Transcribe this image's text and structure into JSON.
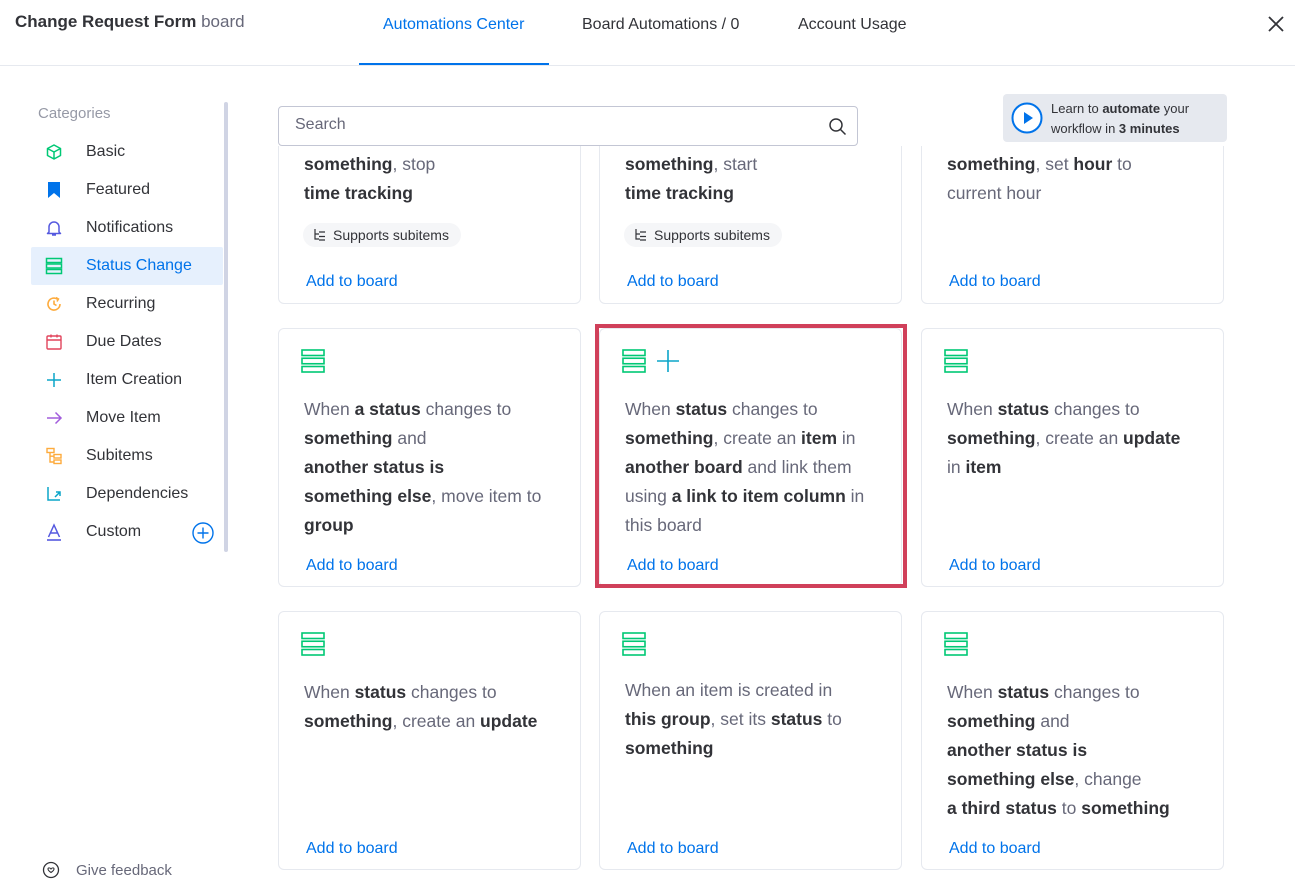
{
  "header": {
    "board_name": "Change Request Form",
    "board_suffix": "board",
    "tabs": [
      {
        "label": "Automations Center",
        "active": true
      },
      {
        "label": "Board Automations / 0",
        "active": false
      },
      {
        "label": "Account Usage",
        "active": false
      }
    ],
    "close_icon": "close-icon"
  },
  "sidebar": {
    "title": "Categories",
    "items": [
      {
        "label": "Basic",
        "icon": "cube-icon"
      },
      {
        "label": "Featured",
        "icon": "bookmark-icon"
      },
      {
        "label": "Notifications",
        "icon": "bell-icon"
      },
      {
        "label": "Status Change",
        "icon": "status-icon",
        "active": true
      },
      {
        "label": "Recurring",
        "icon": "recurring-icon"
      },
      {
        "label": "Due Dates",
        "icon": "calendar-icon"
      },
      {
        "label": "Item Creation",
        "icon": "plus-icon"
      },
      {
        "label": "Move Item",
        "icon": "arrow-right-icon"
      },
      {
        "label": "Subitems",
        "icon": "subitems-icon"
      },
      {
        "label": "Dependencies",
        "icon": "dependencies-icon"
      },
      {
        "label": "Custom",
        "icon": "custom-a-icon"
      }
    ],
    "feedback_label": "Give feedback"
  },
  "search": {
    "placeholder": "Search",
    "value": ""
  },
  "learn": {
    "prefix": "Learn to ",
    "bold1": "automate",
    "mid": " your",
    "line2_prefix": "workflow in ",
    "bold2": "3 minutes"
  },
  "cards": {
    "add_label": "Add to board",
    "badge_label": "Supports subitems",
    "top_row": [
      {
        "line1_bold": "something",
        "line1_rest": ", stop",
        "line2_bold": "time tracking",
        "badge": true
      },
      {
        "line1_bold": "something",
        "line1_rest": ", start",
        "line2_bold": "time tracking",
        "badge": true
      },
      {
        "line1_bold": "something",
        "line1_mid": ", set ",
        "line1_bold2": "hour",
        "line1_rest": " to",
        "line2": "current hour",
        "badge": false
      }
    ]
  },
  "colors": {
    "accent": "#0073ea",
    "status_green": "#00c875",
    "highlight": "#d0405a"
  }
}
